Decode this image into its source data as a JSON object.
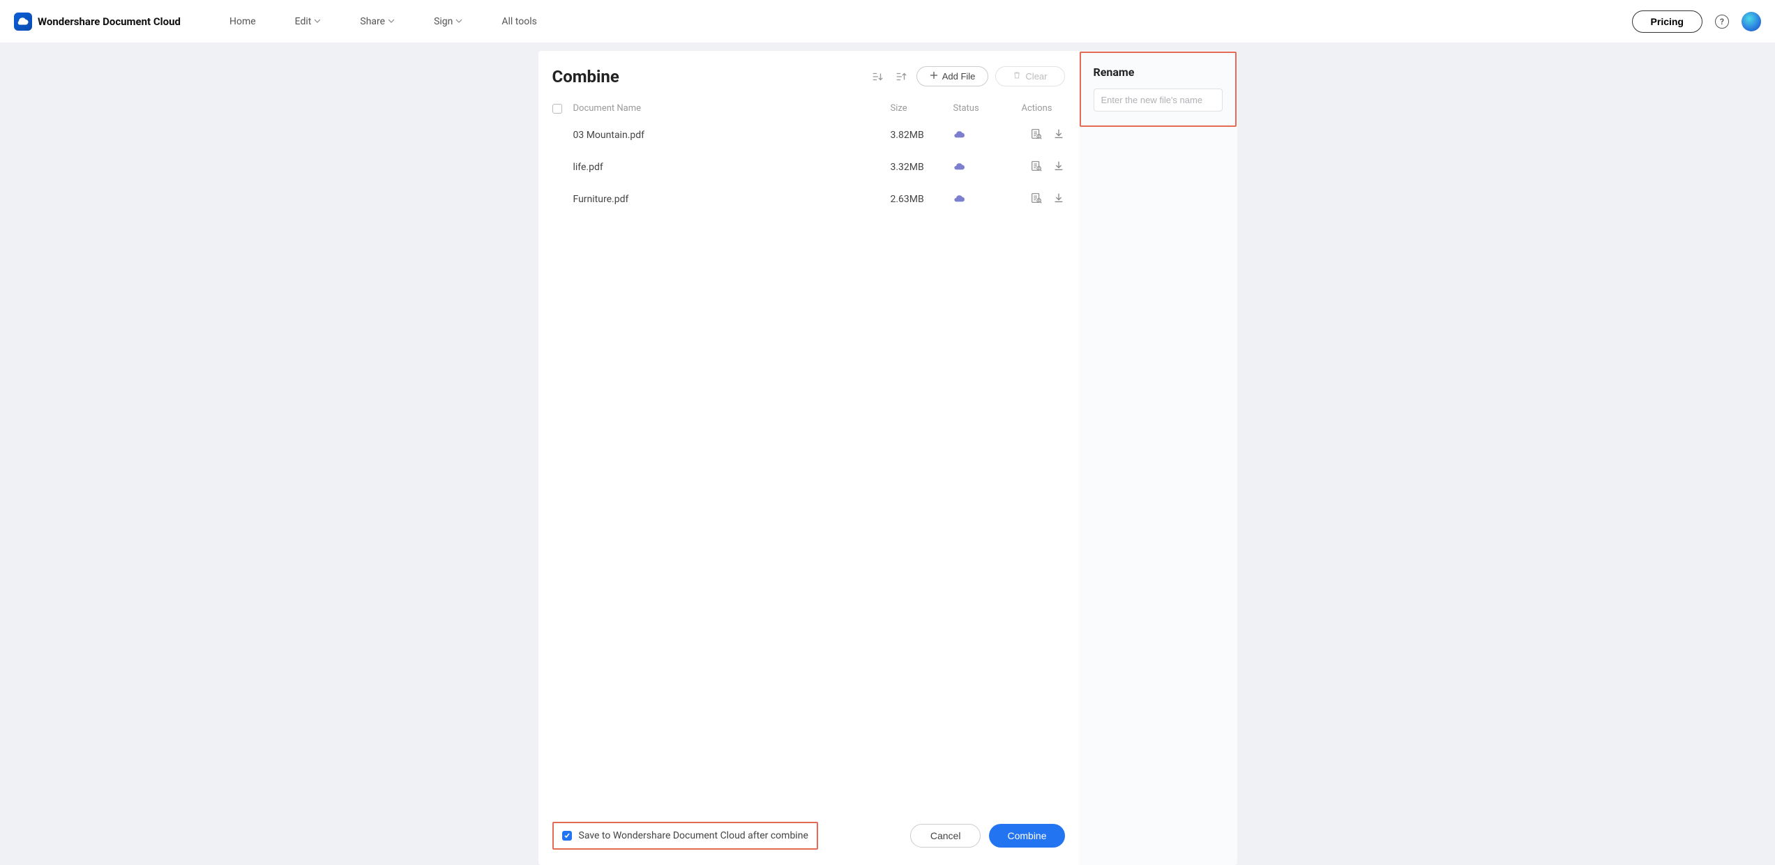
{
  "brand": {
    "name": "Wondershare Document Cloud"
  },
  "nav": {
    "home": "Home",
    "edit": "Edit",
    "share": "Share",
    "sign": "Sign",
    "alltools": "All tools"
  },
  "header": {
    "pricing": "Pricing"
  },
  "panel": {
    "title": "Combine",
    "add_file": "Add File",
    "clear": "Clear",
    "columns": {
      "name": "Document Name",
      "size": "Size",
      "status": "Status",
      "actions": "Actions"
    },
    "files": [
      {
        "name": "03 Mountain.pdf",
        "size": "3.82MB"
      },
      {
        "name": "life.pdf",
        "size": "3.32MB"
      },
      {
        "name": "Furniture.pdf",
        "size": "2.63MB"
      }
    ],
    "save_label": "Save to Wondershare Document Cloud after combine",
    "cancel": "Cancel",
    "combine": "Combine"
  },
  "side": {
    "rename_title": "Rename",
    "rename_placeholder": "Enter the new file's name"
  }
}
